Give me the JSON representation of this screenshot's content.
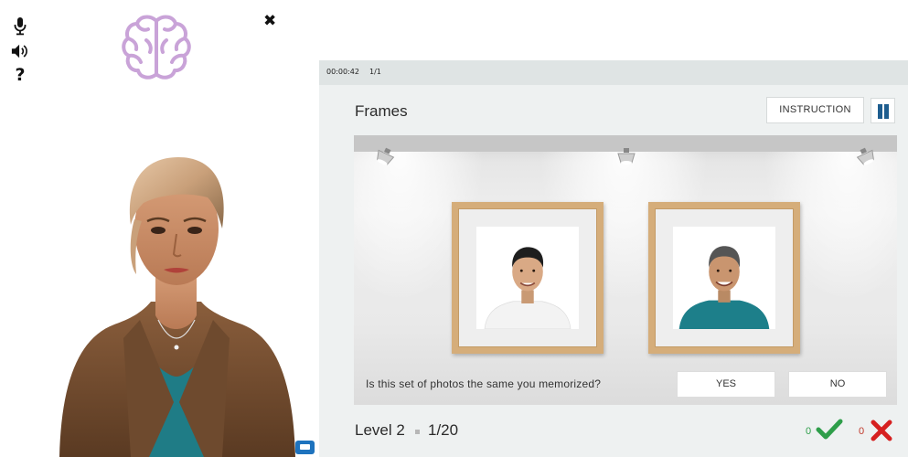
{
  "controls": {
    "mic_icon": "microphone-icon",
    "speaker_icon": "speaker-icon",
    "help_label": "?",
    "close_label": "✖"
  },
  "logo": {
    "icon": "brain-icon",
    "color": "#c9a3d8"
  },
  "game": {
    "timer": "00:00:42",
    "progress": "1/1",
    "title": "Frames",
    "instruction_label": "INSTRUCTION",
    "pause_icon": "pause-icon",
    "question": "Is this set of photos the same you memorized?",
    "yes_label": "YES",
    "no_label": "NO",
    "level_label": "Level 2",
    "count": "1/20",
    "correct_count": "0",
    "wrong_count": "0",
    "colors": {
      "accent": "#1e5d8f",
      "correct": "#2e9e4a",
      "wrong": "#d62020",
      "frame": "#d5ad7a"
    }
  }
}
